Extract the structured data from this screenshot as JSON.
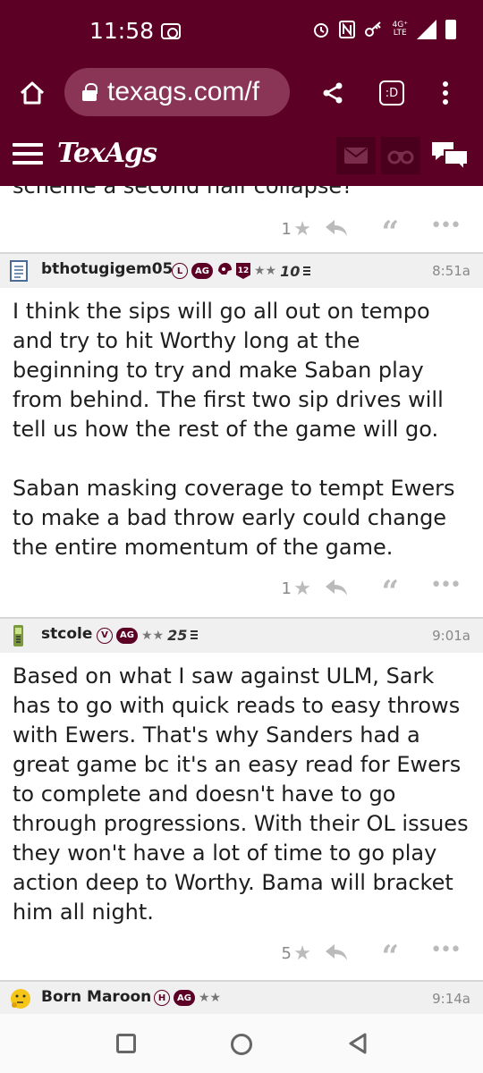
{
  "status_bar": {
    "time": "11:58",
    "network_top": "4G⁺",
    "network_bottom": "LTE"
  },
  "browser": {
    "url": "texags.com/f",
    "tabs_icon_text": ":D"
  },
  "site": {
    "logo": "TexAgs"
  },
  "colors": {
    "brand": "#5c0025",
    "pill": "#8a3556"
  },
  "previous_post": {
    "text_tail": "scheme a second half collapse?",
    "likes": "1"
  },
  "posts": [
    {
      "username": "bthotugigem05",
      "badge_letter": "L",
      "badge_ag": "AG",
      "badge_twelve": "12",
      "stars": "★★",
      "level": "10",
      "time": "8:51a",
      "paragraphs": [
        "I think the sips will go all out on tempo and try to hit Worthy long at the beginning to try and make Saban play from behind. The first two sip drives will tell us how the rest of the game will go.",
        "Saban masking coverage to tempt Ewers to make a bad throw early could change the entire momentum of the game."
      ],
      "likes": "1"
    },
    {
      "username": "stcole",
      "badge_letter": "V",
      "badge_ag": "AG",
      "stars": "★★",
      "level": "25",
      "time": "9:01a",
      "paragraphs": [
        "Based on what I saw against ULM, Sark has to go with quick reads to easy throws with Ewers. That's why Sanders had a great game bc it's an easy read for Ewers to complete and doesn't have to go through progressions. With their OL issues they won't have a lot of time to go play action deep to Worthy. Bama will bracket him all night."
      ],
      "likes": "5"
    },
    {
      "username": "Born Maroon",
      "badge_letter": "H",
      "badge_ag": "AG",
      "stars": "★★",
      "time": "9:14a"
    }
  ]
}
